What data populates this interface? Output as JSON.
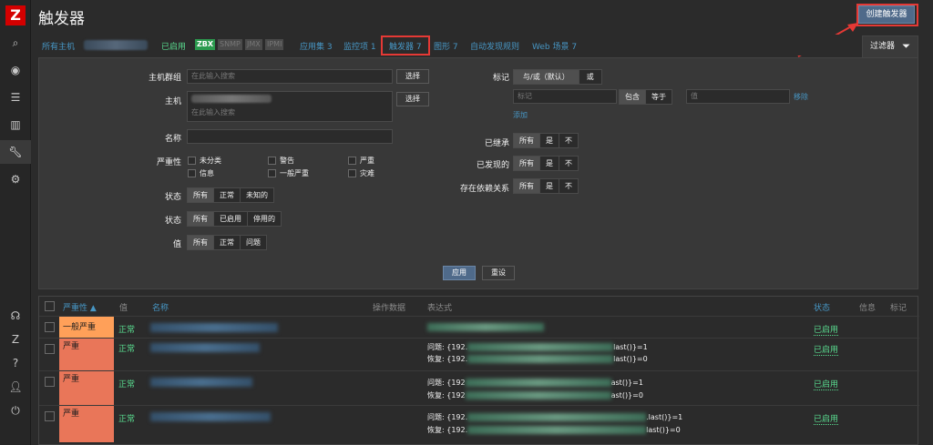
{
  "app": {
    "logo": "Z",
    "title": "触发器",
    "create_button": "创建触发器"
  },
  "nav": {
    "all_hosts": "所有主机",
    "enabled": "已启用",
    "badges": [
      "ZBX",
      "SNMP",
      "JMX",
      "IPMI"
    ],
    "app_sets": "应用集 3",
    "items": "监控项 1",
    "triggers": "触发器 7",
    "graphs": "图形 7",
    "discovery": "自动发现规则",
    "web": "Web 场景 7"
  },
  "filter": {
    "tab_label": "过滤器",
    "host_group_label": "主机群组",
    "host_group_placeholder": "在此输入搜索",
    "select_label": "选择",
    "host_label": "主机",
    "host_placeholder": "在此输入搜索",
    "name_label": "名称",
    "severity_label": "严重性",
    "severities": [
      "未分类",
      "警告",
      "严重",
      "信息",
      "一般严重",
      "灾难"
    ],
    "state_label": "状态",
    "state_options": [
      "所有",
      "正常",
      "未知的"
    ],
    "status_label": "状态",
    "status_options": [
      "所有",
      "已启用",
      "停用的"
    ],
    "value_label": "值",
    "value_options": [
      "所有",
      "正常",
      "问题"
    ],
    "tags_label": "标记",
    "tags_mode": [
      "与/或（默认）",
      "或"
    ],
    "tag_placeholder": "标记",
    "tag_op": [
      "包含",
      "等于"
    ],
    "tag_value_placeholder": "值",
    "remove": "移除",
    "add": "添加",
    "inherited_label": "已继承",
    "discovered_label": "已发现的",
    "deps_label": "存在依赖关系",
    "tri_options": [
      "所有",
      "是",
      "不"
    ],
    "apply": "应用",
    "reset": "重设"
  },
  "table": {
    "headers": {
      "severity": "严重性 ▲",
      "value": "值",
      "name": "名称",
      "ops": "操作数据",
      "expression": "表达式",
      "status": "状态",
      "info": "信息",
      "tags": "标记"
    },
    "rows": [
      {
        "severity": "一般严重",
        "sev_color": "#ffa059",
        "value": "正常",
        "status": "已启用",
        "expr1": "",
        "expr2": ""
      },
      {
        "severity": "严重",
        "sev_color": "#e97659",
        "value": "正常",
        "status": "已启用",
        "expr1_pre": "问题: {192.",
        "expr1_post": "last()}=1",
        "expr2_pre": "恢复: {192.",
        "expr2_post": "last()}=0"
      },
      {
        "severity": "严重",
        "sev_color": "#e97659",
        "value": "正常",
        "status": "已启用",
        "expr1_pre": "问题: {192",
        "expr1_post": "ast()}=1",
        "expr2_pre": "恢复: {192",
        "expr2_post": "ast()}=0"
      },
      {
        "severity": "严重",
        "sev_color": "#e97659",
        "value": "正常",
        "status": "已启用",
        "expr1_pre": "问题: {192.",
        "expr1_post": ".last()}=1",
        "expr2_pre": "恢复: {192.",
        "expr2_post": "last()}=0"
      }
    ]
  },
  "colors": {
    "accent": "#4796c4",
    "ok": "#59db8f",
    "highlight": "#e53935",
    "primary_button": "#4f6a8a"
  }
}
